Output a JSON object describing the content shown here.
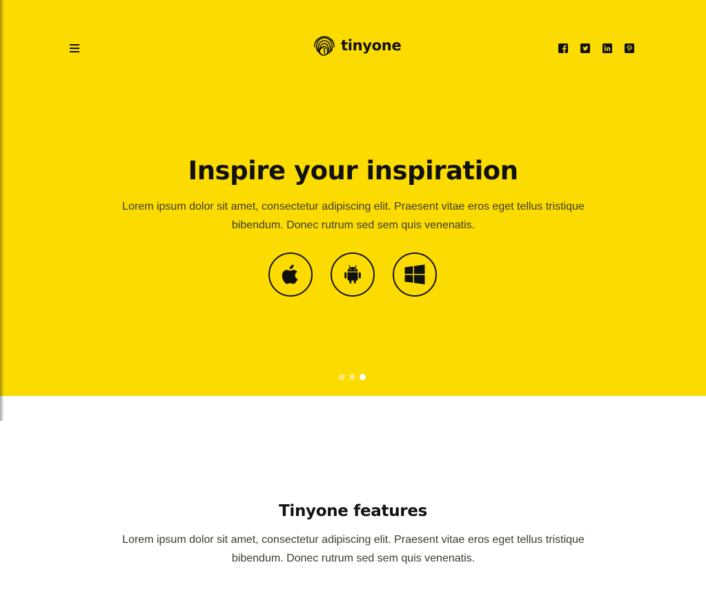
{
  "header": {
    "brand_name": "tinyone",
    "social": [
      "facebook-icon",
      "twitter-icon",
      "linkedin-icon",
      "pinterest-icon"
    ]
  },
  "hero": {
    "title": "Inspire your inspiration",
    "text": "Lorem ipsum dolor sit amet, consectetur adipiscing elit. Praesent vitae eros eget tellus tristique bibendum. Donec rutrum sed sem quis venenatis.",
    "store_icons": [
      "apple-icon",
      "android-icon",
      "windows-icon"
    ],
    "slides": 3,
    "active_slide": 3
  },
  "features": {
    "title": "Tinyone features",
    "text": "Lorem ipsum dolor sit amet, consectetur adipiscing elit. Praesent vitae eros eget tellus tristique bibendum. Donec rutrum sed sem quis venenatis."
  },
  "colors": {
    "accent": "#fcdc00",
    "text_dark": "#111111",
    "body_text": "#3c3a2a"
  }
}
